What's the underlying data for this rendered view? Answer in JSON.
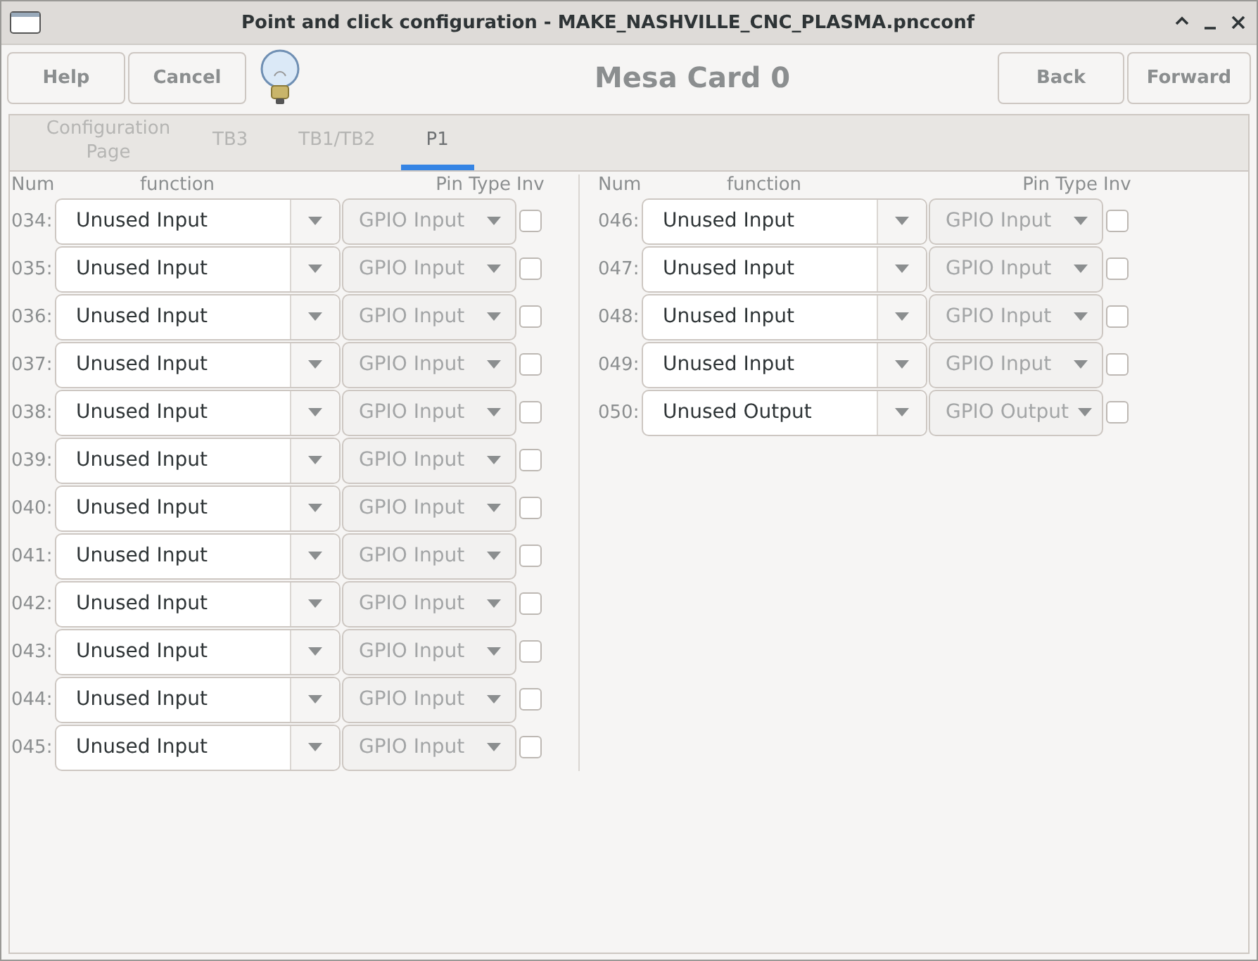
{
  "window": {
    "title": "Point and click configuration - MAKE_NASHVILLE_CNC_PLASMA.pncconf"
  },
  "toolbar": {
    "left_buttons": [
      "Help",
      "Cancel"
    ],
    "heading": "Mesa Card 0",
    "right_buttons": [
      "Back",
      "Forward"
    ]
  },
  "tabs": [
    {
      "label": "Configuration Page",
      "selected": false
    },
    {
      "label": "TB3",
      "selected": false
    },
    {
      "label": "TB1/TB2",
      "selected": false
    },
    {
      "label": "P1",
      "selected": true
    }
  ],
  "panels": [
    {
      "headers": [
        "Num",
        "function",
        "Pin Type",
        "Inv"
      ],
      "rows": [
        {
          "num": "034:",
          "function": "Unused Input",
          "pin_type": "GPIO Input",
          "pin_type_disabled": true,
          "inverted": false
        },
        {
          "num": "035:",
          "function": "Unused Input",
          "pin_type": "GPIO Input",
          "pin_type_disabled": true,
          "inverted": false
        },
        {
          "num": "036:",
          "function": "Unused Input",
          "pin_type": "GPIO Input",
          "pin_type_disabled": true,
          "inverted": false
        },
        {
          "num": "037:",
          "function": "Unused Input",
          "pin_type": "GPIO Input",
          "pin_type_disabled": true,
          "inverted": false
        },
        {
          "num": "038:",
          "function": "Unused Input",
          "pin_type": "GPIO Input",
          "pin_type_disabled": true,
          "inverted": false
        },
        {
          "num": "039:",
          "function": "Unused Input",
          "pin_type": "GPIO Input",
          "pin_type_disabled": true,
          "inverted": false
        },
        {
          "num": "040:",
          "function": "Unused Input",
          "pin_type": "GPIO Input",
          "pin_type_disabled": true,
          "inverted": false
        },
        {
          "num": "041:",
          "function": "Unused Input",
          "pin_type": "GPIO Input",
          "pin_type_disabled": true,
          "inverted": false
        },
        {
          "num": "042:",
          "function": "Unused Input",
          "pin_type": "GPIO Input",
          "pin_type_disabled": true,
          "inverted": false
        },
        {
          "num": "043:",
          "function": "Unused Input",
          "pin_type": "GPIO Input",
          "pin_type_disabled": true,
          "inverted": false
        },
        {
          "num": "044:",
          "function": "Unused Input",
          "pin_type": "GPIO Input",
          "pin_type_disabled": true,
          "inverted": false
        },
        {
          "num": "045:",
          "function": "Unused Input",
          "pin_type": "GPIO Input",
          "pin_type_disabled": true,
          "inverted": false
        }
      ]
    },
    {
      "headers": [
        "Num",
        "function",
        "Pin Type",
        "Inv"
      ],
      "rows": [
        {
          "num": "046:",
          "function": "Unused Input",
          "pin_type": "GPIO Input",
          "pin_type_disabled": true,
          "inverted": false
        },
        {
          "num": "047:",
          "function": "Unused Input",
          "pin_type": "GPIO Input",
          "pin_type_disabled": true,
          "inverted": false
        },
        {
          "num": "048:",
          "function": "Unused Input",
          "pin_type": "GPIO Input",
          "pin_type_disabled": true,
          "inverted": false
        },
        {
          "num": "049:",
          "function": "Unused Input",
          "pin_type": "GPIO Input",
          "pin_type_disabled": true,
          "inverted": false
        },
        {
          "num": "050:",
          "function": "Unused Output",
          "pin_type": "GPIO Output",
          "pin_type_disabled": true,
          "inverted": false
        }
      ]
    }
  ]
}
